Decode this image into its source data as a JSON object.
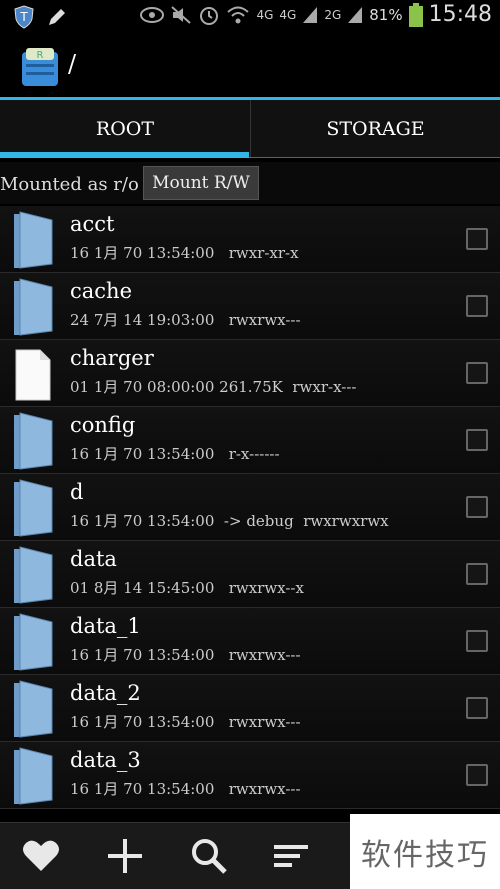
{
  "status_bar": {
    "time": "15:48",
    "battery": "81%",
    "signal_labels": [
      "4G",
      "4G",
      "2G"
    ]
  },
  "title_bar": {
    "path": "/"
  },
  "tabs": [
    {
      "label": "ROOT",
      "selected": true
    },
    {
      "label": "STORAGE",
      "selected": false
    }
  ],
  "mount": {
    "status": "Mounted as r/o",
    "button": "Mount R/W"
  },
  "files": [
    {
      "name": "acct",
      "meta": "16 1月 70 13:54:00   rwxr-xr-x",
      "type": "folder"
    },
    {
      "name": "cache",
      "meta": "24 7月 14 19:03:00   rwxrwx---",
      "type": "folder"
    },
    {
      "name": "charger",
      "meta": "01 1月 70 08:00:00 261.75K  rwxr-x---",
      "type": "file"
    },
    {
      "name": "config",
      "meta": "16 1月 70 13:54:00   r-x------",
      "type": "folder"
    },
    {
      "name": "d",
      "meta": "16 1月 70 13:54:00  -> debug  rwxrwxrwx",
      "type": "folder"
    },
    {
      "name": "data",
      "meta": "01 8月 14 15:45:00   rwxrwx--x",
      "type": "folder"
    },
    {
      "name": "data_1",
      "meta": "16 1月 70 13:54:00   rwxrwx---",
      "type": "folder"
    },
    {
      "name": "data_2",
      "meta": "16 1月 70 13:54:00   rwxrwx---",
      "type": "folder"
    },
    {
      "name": "data_3",
      "meta": "16 1月 70 13:54:00   rwxrwx---",
      "type": "folder"
    }
  ],
  "bottom_bar": [
    "heart-icon",
    "plus-icon",
    "search-icon",
    "sort-icon"
  ],
  "watermark": "软件技巧",
  "colors": {
    "accent": "#33b5e5",
    "folder": "#8fb8de"
  }
}
